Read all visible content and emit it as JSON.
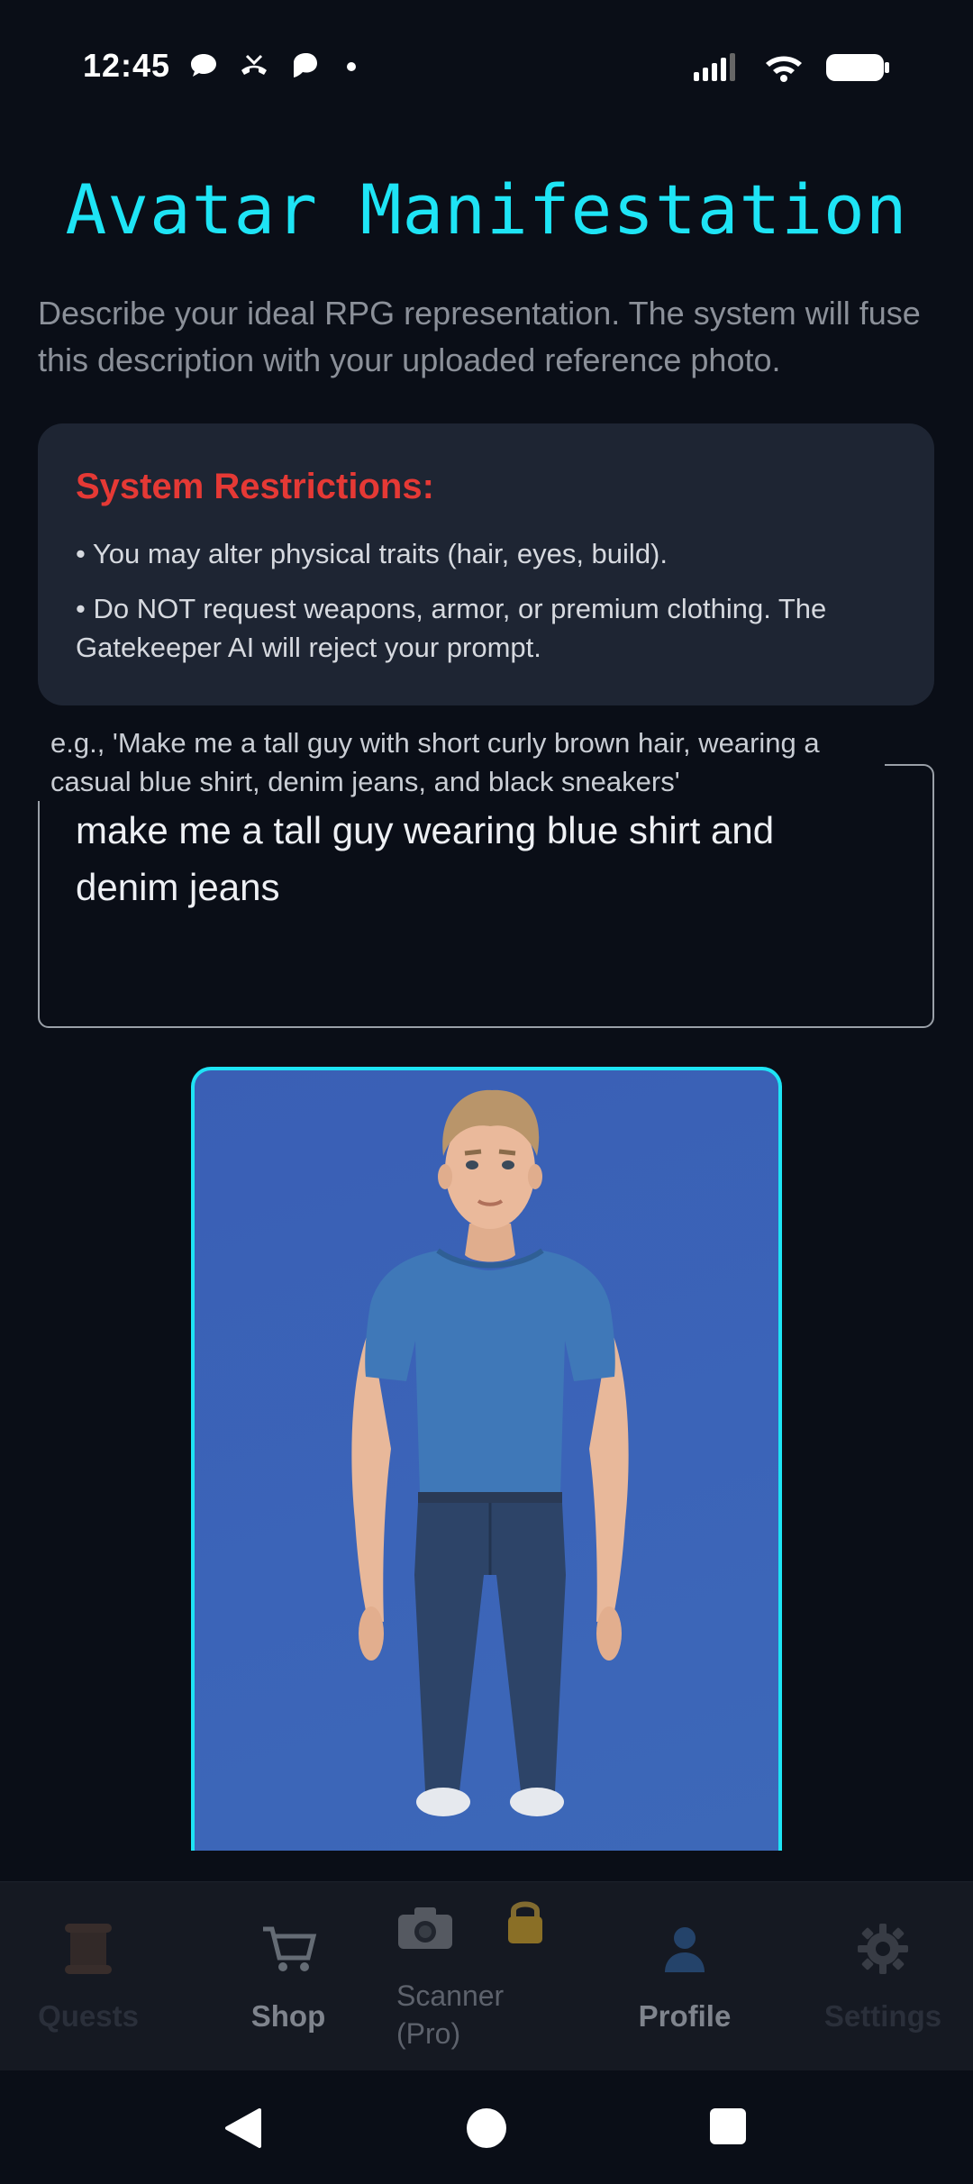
{
  "status_bar": {
    "time": "12:45"
  },
  "header": {
    "title": "Avatar Manifestation",
    "subtitle": "Describe your ideal RPG representation. The system will fuse this description with your uploaded reference photo."
  },
  "restrictions": {
    "title": "System Restrictions:",
    "items": [
      "• You may alter physical traits (hair, eyes, build).",
      "• Do NOT request weapons, armor, or premium clothing. The Gatekeeper AI will reject your prompt."
    ]
  },
  "prompt": {
    "label": "e.g., 'Make me a tall guy with short curly brown hair, wearing a casual blue shirt, denim jeans, and black sneakers'",
    "value": "make me a tall guy wearing blue shirt and denim jeans"
  },
  "bottom_nav": {
    "items": [
      {
        "label": "Quests",
        "icon": "scroll-icon"
      },
      {
        "label": "Shop",
        "icon": "cart-icon"
      },
      {
        "label": "Scanner\n(Pro)",
        "icon": "camera-icon",
        "locked": true
      },
      {
        "label": "Profile",
        "icon": "person-icon"
      },
      {
        "label": "Settings",
        "icon": "gear-icon"
      }
    ]
  },
  "colors": {
    "background": "#0a0e17",
    "accent": "#1ee4f5",
    "warning": "#e53935",
    "card": "#1e2533"
  }
}
